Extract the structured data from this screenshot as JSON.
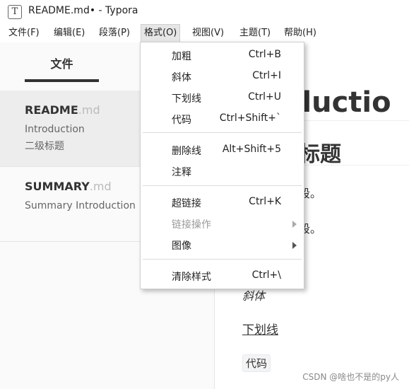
{
  "window": {
    "title": "README.md• - Typora",
    "icon_glyph": "T"
  },
  "menubar": {
    "items": [
      {
        "label": "文件(F)"
      },
      {
        "label": "编辑(E)"
      },
      {
        "label": "段落(P)"
      },
      {
        "label": "格式(O)",
        "active": true
      },
      {
        "label": "视图(V)"
      },
      {
        "label": "主题(T)"
      },
      {
        "label": "帮助(H)"
      }
    ]
  },
  "sidebar": {
    "tab_label": "文件",
    "files": [
      {
        "name": "README",
        "ext": ".md",
        "lines": [
          "Introduction",
          "二级标题"
        ],
        "selected": true
      },
      {
        "name": "SUMMARY",
        "ext": ".md",
        "lines": [
          "Summary Introduction"
        ],
        "selected": false
      }
    ]
  },
  "editor": {
    "h1": "oductio",
    "h2": "标题",
    "paragraphs": [
      "段。",
      "段。"
    ],
    "italic": "斜体",
    "underline": "下划线",
    "code": "代码"
  },
  "format_menu": {
    "items": [
      {
        "label": "加粗",
        "shortcut": "Ctrl+B"
      },
      {
        "label": "斜体",
        "shortcut": "Ctrl+I"
      },
      {
        "label": "下划线",
        "shortcut": "Ctrl+U"
      },
      {
        "label": "代码",
        "shortcut": "Ctrl+Shift+`"
      },
      {
        "label": "删除线",
        "shortcut": "Alt+Shift+5"
      },
      {
        "label": "注释",
        "shortcut": ""
      },
      {
        "label": "超链接",
        "shortcut": "Ctrl+K"
      },
      {
        "label": "链接操作",
        "shortcut": "",
        "disabled": true,
        "submenu": true
      },
      {
        "label": "图像",
        "shortcut": "",
        "submenu": true
      },
      {
        "label": "清除样式",
        "shortcut": "Ctrl+\\"
      }
    ]
  },
  "watermark": "CSDN @啥也不是的py人",
  "colors": {
    "menu_active_bg": "#e6e6e6",
    "sidebar_bg": "#fafafa",
    "selected_file_bg": "#ededed",
    "disabled_text": "#9a9a9a"
  }
}
